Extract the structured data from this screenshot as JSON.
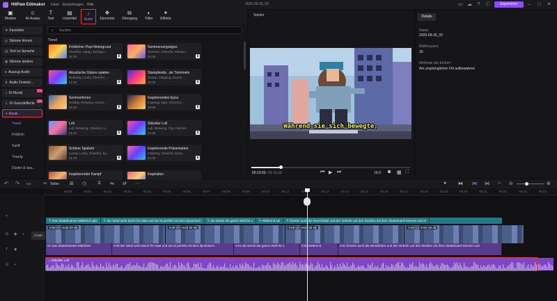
{
  "titlebar": {
    "app_name": "HitPaw Edimakor",
    "menu": [
      "Datei",
      "Einstellungen",
      "Hilfe"
    ],
    "document": "2025-09-26_03",
    "export_label": "Exportieren"
  },
  "toolbar": {
    "tools": [
      {
        "label": "Medien",
        "icon": "media-icon",
        "glyph": "▣"
      },
      {
        "label": "AI-Avatar",
        "icon": "avatar-icon",
        "glyph": "☺"
      },
      {
        "label": "Text",
        "icon": "text-icon",
        "glyph": "T"
      },
      {
        "label": "Untertitel",
        "icon": "subtitle-icon",
        "glyph": "▤"
      },
      {
        "label": "Audio",
        "icon": "music-note-icon",
        "glyph": "♪"
      },
      {
        "label": "Elemente",
        "icon": "elements-icon",
        "glyph": "❖"
      },
      {
        "label": "Übergang",
        "icon": "transition-icon",
        "glyph": "⧉"
      },
      {
        "label": "Filter",
        "icon": "filter-icon",
        "glyph": "◐"
      },
      {
        "label": "Effekte",
        "icon": "effects-icon",
        "glyph": "✦"
      }
    ]
  },
  "sidebar": {
    "items": [
      {
        "label": "Favoriten",
        "icon": "star-icon",
        "glyph": "★"
      },
      {
        "label": "Stimme klonen",
        "icon": "voice-clone-icon",
        "glyph": "◎"
      },
      {
        "label": "Text zu Sprache",
        "icon": "tts-icon",
        "glyph": "▤"
      },
      {
        "label": "Stimme ändern",
        "icon": "voice-change-icon",
        "glyph": "◉"
      },
      {
        "label": "Auszug Audio",
        "icon": "mic-icon",
        "glyph": "●"
      },
      {
        "label": "Audio Downlo...",
        "icon": "download-icon",
        "glyph": "⬇"
      },
      {
        "label": "KI-Musik",
        "icon": "ai-music-icon",
        "glyph": "♫"
      },
      {
        "label": "KI-Soundeffecte",
        "icon": "sound-effect-icon",
        "glyph": "♬"
      },
      {
        "label": "Musik",
        "icon": "music-icon",
        "glyph": "▾"
      }
    ],
    "subitems": [
      "Trend",
      "Fröhlich",
      "Sanft",
      "Traurig",
      "Düster & spa..."
    ]
  },
  "library": {
    "search_placeholder": "Suchen",
    "section": "Trend",
    "cards": [
      {
        "title": "Fröhlicher Pop-Hintergrund",
        "desc": "Cheerful, Happy, Backgro...",
        "dur": "01:00"
      },
      {
        "title": "Sommervergnügen",
        "desc": "Summer, Cheerful, Pleasur...",
        "dur": "01:00"
      },
      {
        "title": "Akustische Gitarre spielen",
        "desc": "Relaxing, Lively, Cheerful, ...",
        "dur": "01:00"
      },
      {
        "title": "Stampfende...de Trommeln",
        "desc": "Stomp, Clapping, Drums, ...",
        "dur": "01:00"
      },
      {
        "title": "Sommerferien",
        "desc": "Holiday, Relaxing, Summ...",
        "dur": "02:40"
      },
      {
        "title": "Inspirierendes Epos",
        "desc": "Inspiring, Epic, Cheerful, ...",
        "dur": "02:09"
      },
      {
        "title": "Lofi",
        "desc": "Lofi, Relaxing, Cheerful, U...",
        "dur": "01:00"
      },
      {
        "title": "Stilvoller Lofi",
        "desc": "Lofi, Relaxing, City, Fashion",
        "dur": "01:00"
      },
      {
        "title": "Schöne Spieluhr",
        "desc": "Lovely, Lively, Cheerful, Sy...",
        "dur": "01:00"
      },
      {
        "title": "Inspirierende Präsentation",
        "desc": "Inspiring, Cheerful, Dyna...",
        "dur": "01:00"
      },
      {
        "title": "Inspirierender Kampf",
        "desc": "",
        "dur": ""
      },
      {
        "title": "Inspiration",
        "desc": "",
        "dur": ""
      }
    ]
  },
  "player": {
    "title": "Spieler",
    "subtitle": "Während sie sich bewegte,",
    "time_current": "00:13:03",
    "time_total": "/ 01:11:10",
    "aspect": "16:9",
    "progress": 0.18
  },
  "details": {
    "tab": "Details",
    "fields": [
      {
        "label": "Name",
        "value": "2025-09-26_03"
      },
      {
        "label": "Bildfrequenz",
        "value": "30"
      },
      {
        "label": "Methode der Einfuhr",
        "value": "Am ursprünglichen Ort aufbewahren"
      }
    ]
  },
  "timeline": {
    "split_label": "Teilen",
    "ticks": [
      "00:00",
      "00:01",
      "00:02",
      "00:03",
      "00:04",
      "00:05",
      "00:06",
      "00:07",
      "00:08",
      "00:09",
      "00:10",
      "00:11",
      "00:12",
      "00:13",
      "00:14",
      "00:15",
      "00:16",
      "00:17",
      "00:18",
      "00:19",
      "00:20",
      "00:21",
      "00:22",
      "00:23",
      "00:24"
    ],
    "subtitle_clips": [
      "Das Skateboarder-Mädchen glei",
      "der Wind weht durch ihr Haar und sie ist perfekt mit dem dynamisch",
      "als würde die ganze Welt für s",
      "Während sie",
      "flossen auch die Neonlichter und der Verkehr auf den Straßen mit ihrer Skateboard-Strecke und er"
    ],
    "video_clips": [
      "0:08 UV 2025 09 26",
      "0:08 UV 2025 09 26",
      "0:08 UV 2025 09 26",
      "0:08 UV 2025 09 26"
    ],
    "cover_label": "Cover",
    "caption_clips": [
      "01 Das Skateboarder-Mädchen",
      "0:05 der Wind weht durch ihr Haar und sie ist perfekt mit dem dynamisch",
      "0:01 als würde die ganze Welt für s",
      "0:01 Während",
      "0:01 flossen auch die Neonlichter und der Verkehr auf den Straßen mit ihrer Skateboard-Strecke und"
    ],
    "music_clip": "Stilvoller Lofi"
  },
  "colors": {
    "accent": "#8a4dff",
    "highlight": "#e03b3b",
    "subtitle_track": "#1d7a87",
    "music_track": "#7d45c7"
  }
}
